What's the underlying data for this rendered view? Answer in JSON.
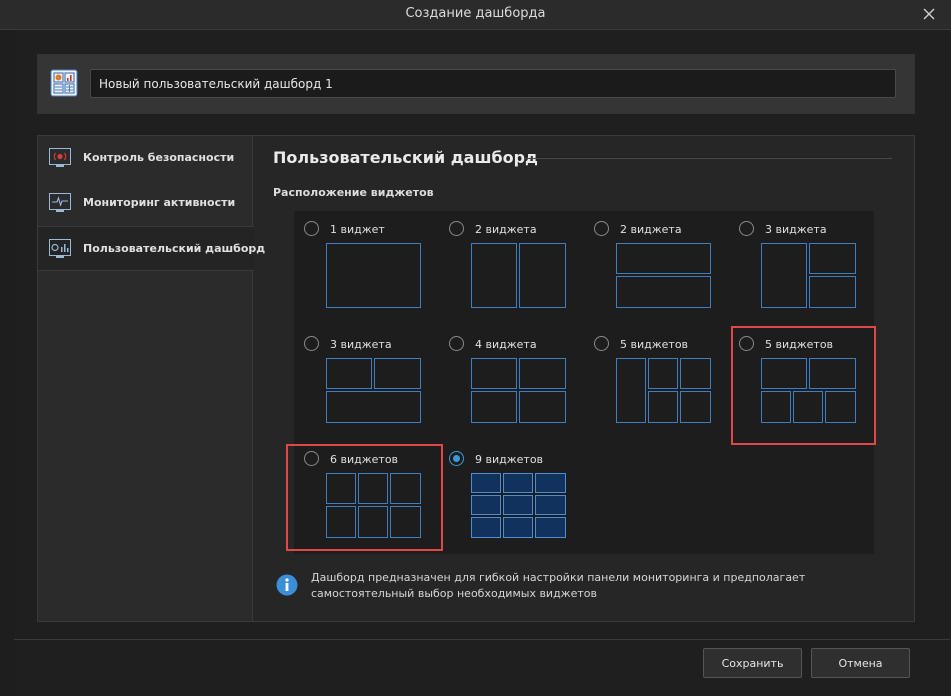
{
  "window": {
    "title": "Создание дашборда",
    "close_icon": "close-icon"
  },
  "dashboard_name": {
    "value": "Новый пользовательский дашборд 1",
    "icon": "dashboard-icon"
  },
  "sidebar": {
    "items": [
      {
        "label": "Контроль безопасности",
        "icon": "security-alarm-icon",
        "active": false
      },
      {
        "label": "Мониторинг активности",
        "icon": "activity-monitor-icon",
        "active": false
      },
      {
        "label": "Пользовательский дашборд",
        "icon": "custom-dashboard-icon",
        "active": true
      }
    ]
  },
  "content": {
    "title": "Пользовательский дашборд",
    "layout_section_label": "Расположение виджетов",
    "layouts": [
      {
        "label": "1 виджет",
        "selected": false,
        "highlighted": false
      },
      {
        "label": "2 виджета",
        "selected": false,
        "highlighted": false
      },
      {
        "label": "2 виджета",
        "selected": false,
        "highlighted": false
      },
      {
        "label": "3 виджета",
        "selected": false,
        "highlighted": false
      },
      {
        "label": "3 виджета",
        "selected": false,
        "highlighted": false
      },
      {
        "label": "4 виджета",
        "selected": false,
        "highlighted": false
      },
      {
        "label": "5 виджетов",
        "selected": false,
        "highlighted": false
      },
      {
        "label": "5 виджетов",
        "selected": false,
        "highlighted": true
      },
      {
        "label": "6 виджетов",
        "selected": false,
        "highlighted": true
      },
      {
        "label": "9 виджетов",
        "selected": true,
        "highlighted": false
      }
    ],
    "info_icon": "info-icon",
    "info_text": "Дашборд предназначен для гибкой настройки панели мониторинга и предполагает самостоятельный выбор необходимых виджетов"
  },
  "footer": {
    "save_label": "Сохранить",
    "cancel_label": "Отмена"
  },
  "colors": {
    "accent": "#3a9ad9",
    "highlight": "#e04848",
    "cell_border": "#3f7fc0",
    "selected_fill": "#11325c"
  }
}
